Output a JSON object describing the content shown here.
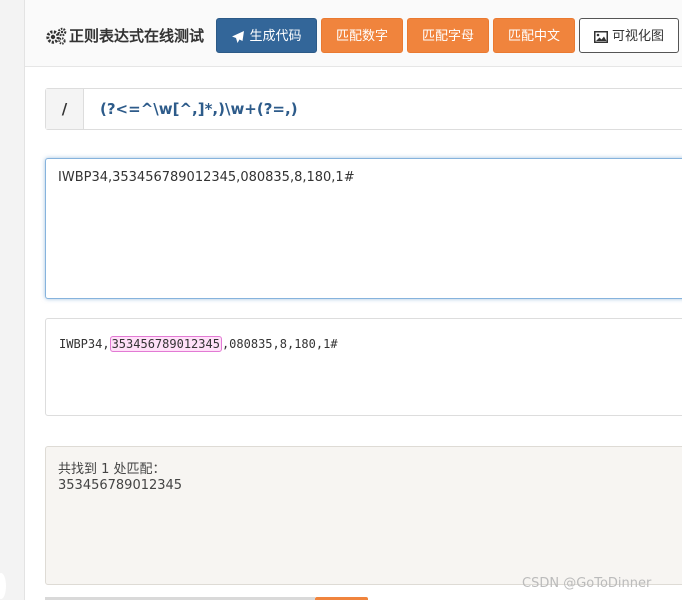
{
  "header": {
    "title": "正则表达式在线测试",
    "title_icon": "gears-icon",
    "buttons": {
      "generate_code": "生成代码",
      "generate_code_icon": "paper-plane-icon",
      "match_digits": "匹配数字",
      "match_letters": "匹配字母",
      "match_chinese": "匹配中文",
      "visualize": "可视化图",
      "visualize_icon": "image-icon"
    }
  },
  "regex": {
    "delimiter": "/",
    "pattern": "(?<=^\\w[^,]*,)\\w+(?=,)"
  },
  "input": {
    "text": "IWBP34,353456789012345,080835,8,180,1#"
  },
  "result": {
    "before": "IWBP34,",
    "match": "353456789012345",
    "after": ",080835,8,180,1#"
  },
  "summary": {
    "label": "共找到 1 处匹配：",
    "matches": "353456789012345"
  },
  "watermark": "CSDN @GoToDinner",
  "colors": {
    "primary": "#336699",
    "orange": "#f0843d",
    "regex_text": "#2d5b8a",
    "match_bg": "#ffe0f8",
    "match_border": "#e27ad4"
  }
}
